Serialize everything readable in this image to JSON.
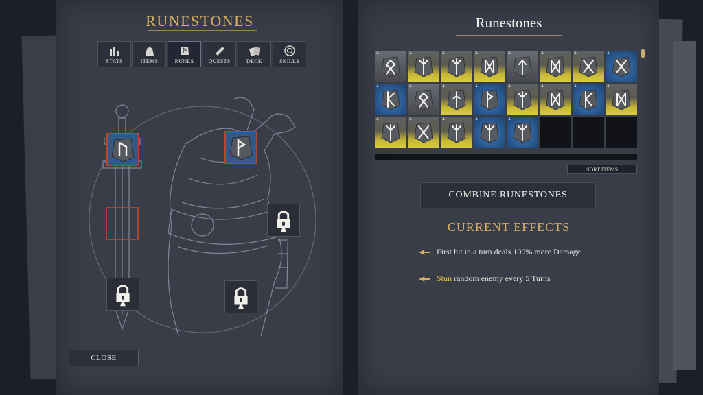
{
  "left_panel": {
    "title": "RUNESTONES",
    "tabs": [
      {
        "label": "STATS",
        "icon": "stats-icon"
      },
      {
        "label": "ITEMS",
        "icon": "items-bag-icon"
      },
      {
        "label": "RUNES",
        "icon": "rune-stone-icon"
      },
      {
        "label": "QUESTS",
        "icon": "scroll-icon"
      },
      {
        "label": "DECK",
        "icon": "cards-icon"
      },
      {
        "label": "SKILLS",
        "icon": "skill-circle-icon"
      }
    ],
    "active_tab": "RUNES",
    "close_label": "CLOSE"
  },
  "right_panel": {
    "title": "Runestones",
    "sort_label": "SORT ITEMS",
    "combine_label": "COMBINE RUNESTONES",
    "effects_title": "CURRENT EFFECTS",
    "effect1_text": "First hit in a turn deals 100% more Damage",
    "effect2_highlight": "Stun",
    "effect2_text": " random enemy every 5 Turns",
    "inventory": [
      {
        "qty": "1",
        "bg": "gray",
        "rune": "othala"
      },
      {
        "qty": "1",
        "bg": "yellow",
        "rune": "algiz"
      },
      {
        "qty": "1",
        "bg": "yellow",
        "rune": "algiz"
      },
      {
        "qty": "1",
        "bg": "yellow",
        "rune": "dagaz"
      },
      {
        "qty": "1",
        "bg": "gray",
        "rune": "tiwaz"
      },
      {
        "qty": "1",
        "bg": "yellow",
        "rune": "dagaz"
      },
      {
        "qty": "1",
        "bg": "yellow",
        "rune": "gebo"
      },
      {
        "qty": "1",
        "bg": "blue",
        "rune": "gebo"
      },
      {
        "qty": "1",
        "bg": "blue",
        "rune": "kaunan"
      },
      {
        "qty": "1",
        "bg": "gray",
        "rune": "othala"
      },
      {
        "qty": "1",
        "bg": "yellow",
        "rune": "ingwaz"
      },
      {
        "qty": "1",
        "bg": "blue",
        "rune": "wunjo"
      },
      {
        "qty": "1",
        "bg": "yellow",
        "rune": "algiz"
      },
      {
        "qty": "1",
        "bg": "yellow",
        "rune": "dagaz"
      },
      {
        "qty": "1",
        "bg": "blue",
        "rune": "kaunan"
      },
      {
        "qty": "1",
        "bg": "yellow",
        "rune": "dagaz"
      },
      {
        "qty": "1",
        "bg": "yellow",
        "rune": "algiz"
      },
      {
        "qty": "1",
        "bg": "yellow",
        "rune": "gebo"
      },
      {
        "qty": "1",
        "bg": "yellow",
        "rune": "algiz"
      },
      {
        "qty": "1",
        "bg": "blue",
        "rune": "algiz"
      },
      {
        "qty": "1",
        "bg": "blue",
        "rune": "algiz"
      },
      {
        "qty": "",
        "bg": "empty",
        "rune": ""
      },
      {
        "qty": "",
        "bg": "empty",
        "rune": ""
      },
      {
        "qty": "",
        "bg": "empty",
        "rune": ""
      }
    ]
  },
  "colors": {
    "gold": "#d9b064",
    "panel": "#393d48",
    "slot_border_red": "#b8472f",
    "rune_blue": "#2f5a8a",
    "highlight_yellow": "#e6c23a"
  }
}
